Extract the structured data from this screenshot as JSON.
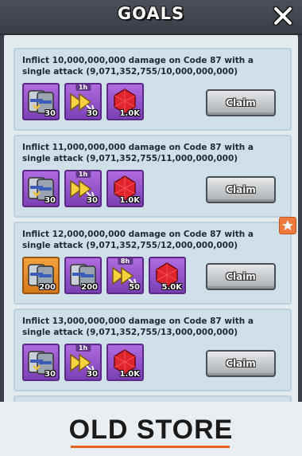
{
  "header": {
    "title": "GOALS"
  },
  "goals": [
    {
      "text": "Inflict 10,000,000,000 damage on Code 87 with a single attack (9,071,352,755/10,000,000,000)",
      "claim": "Claim",
      "rewards": [
        {
          "kind": "gear-chest",
          "color": "purple",
          "qty": "30",
          "dur": ""
        },
        {
          "kind": "speedup-arrow",
          "color": "purple",
          "qty": "30",
          "dur": "1h"
        },
        {
          "kind": "ruby",
          "color": "purple",
          "qty": "1.0K",
          "dur": ""
        }
      ]
    },
    {
      "text": "Inflict 11,000,000,000 damage on Code 87 with a single attack (9,071,352,755/11,000,000,000)",
      "claim": "Claim",
      "rewards": [
        {
          "kind": "gear-chest",
          "color": "purple",
          "qty": "30",
          "dur": ""
        },
        {
          "kind": "speedup-arrow",
          "color": "purple",
          "qty": "30",
          "dur": "1h"
        },
        {
          "kind": "ruby",
          "color": "purple",
          "qty": "1.0K",
          "dur": ""
        }
      ]
    },
    {
      "text": "Inflict 12,000,000,000 damage on Code 87 with a single attack (9,071,352,755/12,000,000,000)",
      "claim": "Claim",
      "starred": true,
      "rewards": [
        {
          "kind": "gear-chest",
          "color": "orange",
          "qty": "200",
          "dur": ""
        },
        {
          "kind": "gear-chest",
          "color": "purple",
          "qty": "200",
          "dur": ""
        },
        {
          "kind": "speedup-arrow",
          "color": "purple",
          "qty": "50",
          "dur": "8h"
        },
        {
          "kind": "ruby",
          "color": "purple",
          "qty": "5.0K",
          "dur": ""
        }
      ]
    },
    {
      "text": "Inflict 13,000,000,000 damage on Code 87 with a single attack (9,071,352,755/13,000,000,000)",
      "claim": "Claim",
      "rewards": [
        {
          "kind": "gear-chest",
          "color": "purple",
          "qty": "30",
          "dur": ""
        },
        {
          "kind": "speedup-arrow",
          "color": "purple",
          "qty": "30",
          "dur": "1h"
        },
        {
          "kind": "ruby",
          "color": "purple",
          "qty": "1.0K",
          "dur": ""
        }
      ]
    }
  ],
  "footer": {
    "store_label": "OLD STORE"
  },
  "colors": {
    "accent": "#e8621f",
    "claim_button": "#c9cdd0",
    "card": "#cfe0e8"
  }
}
